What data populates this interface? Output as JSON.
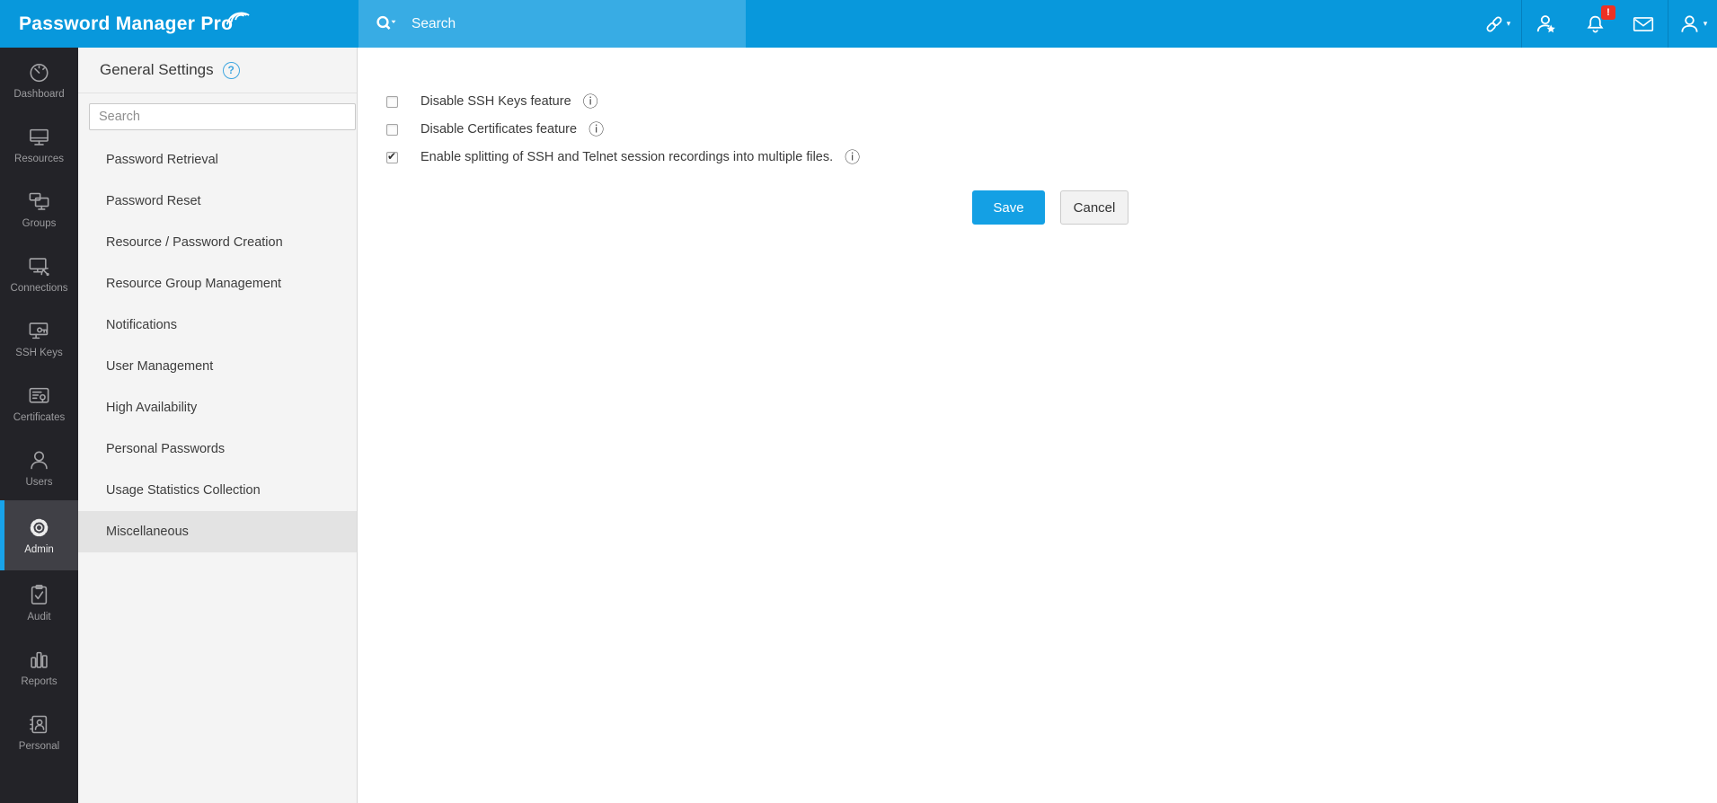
{
  "topbar": {
    "logo": "Password Manager Pro",
    "search_placeholder": "Search",
    "notification_badge": "!"
  },
  "glyphs": {
    "caret": "▾",
    "info": "ⓘ",
    "help": "?"
  },
  "sidenav": {
    "items": [
      {
        "label": "Dashboard",
        "active": false
      },
      {
        "label": "Resources",
        "active": false
      },
      {
        "label": "Groups",
        "active": false
      },
      {
        "label": "Connections",
        "active": false
      },
      {
        "label": "SSH Keys",
        "active": false
      },
      {
        "label": "Certificates",
        "active": false
      },
      {
        "label": "Users",
        "active": false
      },
      {
        "label": "Admin",
        "active": true
      },
      {
        "label": "Audit",
        "active": false
      },
      {
        "label": "Reports",
        "active": false
      },
      {
        "label": "Personal",
        "active": false
      }
    ]
  },
  "settings_panel": {
    "title": "General Settings",
    "search_placeholder": "Search",
    "items": [
      {
        "label": "Password Retrieval",
        "active": false
      },
      {
        "label": "Password Reset",
        "active": false
      },
      {
        "label": "Resource / Password Creation",
        "active": false
      },
      {
        "label": "Resource Group Management",
        "active": false
      },
      {
        "label": "Notifications",
        "active": false
      },
      {
        "label": "User Management",
        "active": false
      },
      {
        "label": "High Availability",
        "active": false
      },
      {
        "label": "Personal Passwords",
        "active": false
      },
      {
        "label": "Usage Statistics Collection",
        "active": false
      },
      {
        "label": "Miscellaneous",
        "active": true
      }
    ]
  },
  "main": {
    "options": [
      {
        "label": "Disable SSH Keys feature",
        "checked": false
      },
      {
        "label": "Disable Certificates feature",
        "checked": false
      },
      {
        "label": "Enable splitting of SSH and Telnet session recordings into multiple files.",
        "checked": true
      }
    ],
    "save_label": "Save",
    "cancel_label": "Cancel"
  },
  "colors": {
    "topbar": "#0898dc",
    "search_region": "#38ace4",
    "sidenav_bg": "#232328",
    "active_accent": "#18a3ea",
    "panel_bg": "#f4f4f4",
    "save_button": "#14a0e4",
    "badge_red": "#ee3124"
  }
}
